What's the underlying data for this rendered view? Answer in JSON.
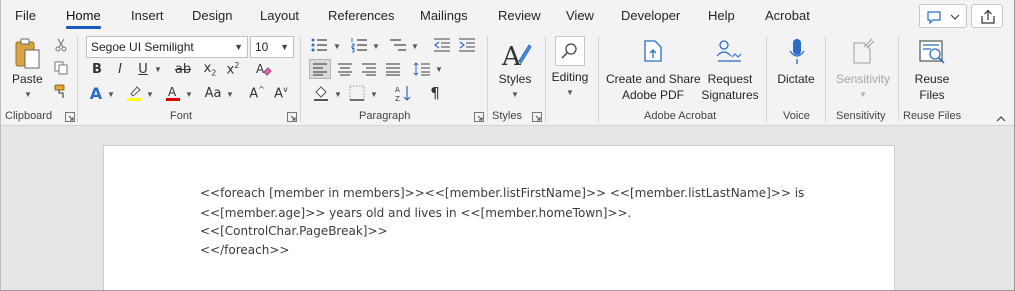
{
  "tabs": [
    "File",
    "Home",
    "Insert",
    "Design",
    "Layout",
    "References",
    "Mailings",
    "Review",
    "View",
    "Developer",
    "Help",
    "Acrobat"
  ],
  "active_tab": "Home",
  "clipboard": {
    "paste_label": "Paste",
    "group_label": "Clipboard"
  },
  "font": {
    "name": "Segoe UI Semilight",
    "size": "10",
    "group_label": "Font",
    "case_label": "Aa",
    "grow_label": "A",
    "shrink_label": "A"
  },
  "paragraph": {
    "group_label": "Paragraph"
  },
  "styles": {
    "label": "Styles",
    "group_label": "Styles"
  },
  "editing": {
    "label": "Editing"
  },
  "acrobat": {
    "create_line1": "Create and Share",
    "create_line2": "Adobe PDF",
    "request_line1": "Request",
    "request_line2": "Signatures",
    "group_label": "Adobe Acrobat"
  },
  "voice": {
    "dictate_label": "Dictate",
    "group_label": "Voice"
  },
  "sensitivity": {
    "label": "Sensitivity",
    "group_label": "Sensitivity"
  },
  "reuse": {
    "line1": "Reuse",
    "line2": "Files",
    "group_label": "Reuse Files"
  },
  "colors": {
    "accent": "#185abd",
    "highlight": "#ffff00",
    "font_color": "#e00000",
    "text_effect": "#2b6cc4"
  },
  "document": {
    "lines": [
      "<<foreach [member in members]>><<[member.listFirstName]>> <<[member.listLastName]>> is",
      "<<[member.age]>> years old and lives in <<[member.homeTown]>>.",
      "<<[ControlChar.PageBreak]>>",
      "<</foreach>>"
    ]
  }
}
